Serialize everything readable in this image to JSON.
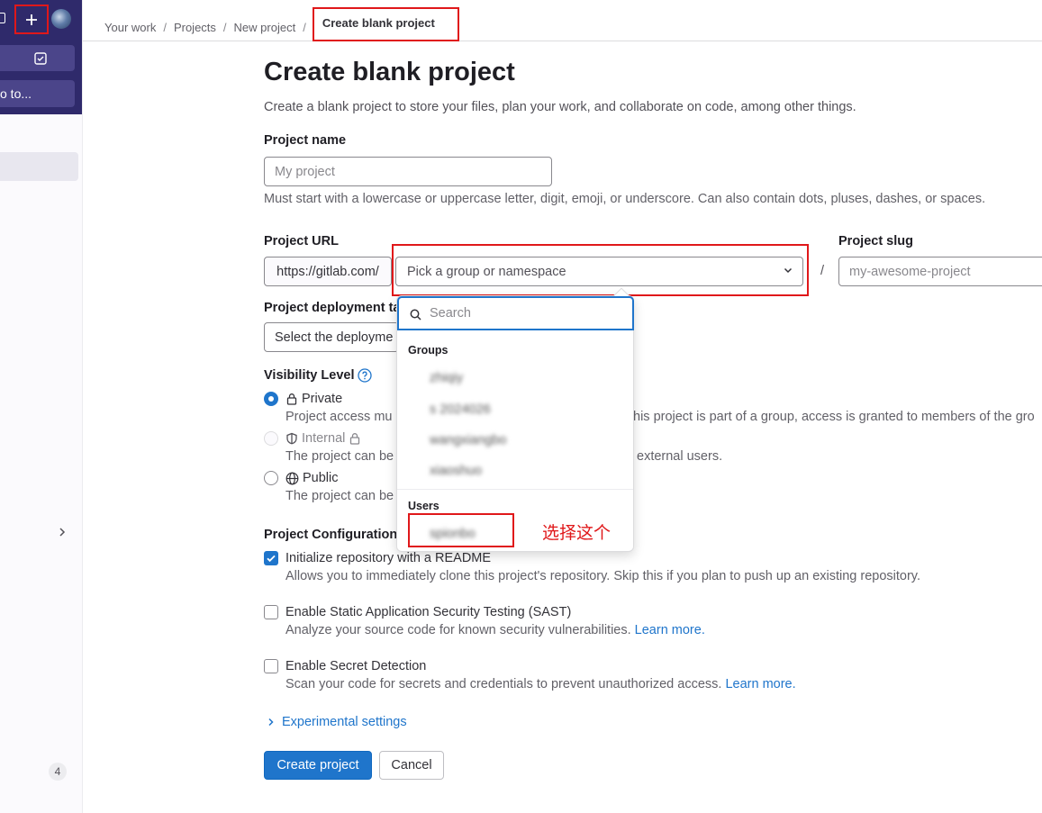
{
  "sidebar": {
    "plus_icon": "plus-icon",
    "todo_icon": "checkbox-icon",
    "goto_label": "o to...",
    "collapse_icon": "chevron-right-icon",
    "badge_count": "4"
  },
  "breadcrumbs": [
    {
      "label": "Your work"
    },
    {
      "label": "Projects"
    },
    {
      "label": "New project"
    },
    {
      "label": "Create blank project"
    }
  ],
  "page": {
    "title": "Create blank project",
    "subtitle": "Create a blank project to store your files, plan your work, and collaborate on code, among other things."
  },
  "form": {
    "project_name": {
      "label": "Project name",
      "placeholder": "My project",
      "hint": "Must start with a lowercase or uppercase letter, digit, emoji, or underscore. Can also contain dots, pluses, dashes, or spaces."
    },
    "project_url": {
      "label": "Project URL",
      "prefix": "https://gitlab.com/",
      "namespace_placeholder": "Pick a group or namespace",
      "separator": "/"
    },
    "project_slug": {
      "label": "Project slug",
      "placeholder": "my-awesome-project"
    },
    "deployment": {
      "label": "Project deployment ta",
      "placeholder": "Select the deployme"
    },
    "visibility": {
      "label": "Visibility Level",
      "help_icon": "question-circle-icon",
      "options": [
        {
          "label": "Private",
          "icon": "lock-icon",
          "selected": true,
          "desc_left": "Project access mu",
          "desc_right": "his project is part of a group, access is granted to members of the gro"
        },
        {
          "label": "Internal",
          "icon": "shield-icon",
          "disabled": true,
          "desc_left": "The project can be",
          "desc_right": "external users."
        },
        {
          "label": "Public",
          "icon": "globe-icon",
          "desc_left": "The project can be"
        }
      ]
    },
    "configuration": {
      "label": "Project Configuration",
      "items": [
        {
          "label": "Initialize repository with a README",
          "checked": true,
          "desc": "Allows you to immediately clone this project's repository. Skip this if you plan to push up an existing repository."
        },
        {
          "label": "Enable Static Application Security Testing (SAST)",
          "checked": false,
          "desc": "Analyze your source code for known security vulnerabilities.",
          "link": "Learn more."
        },
        {
          "label": "Enable Secret Detection",
          "checked": false,
          "desc": "Scan your code for secrets and credentials to prevent unauthorized access.",
          "link": "Learn more."
        }
      ]
    },
    "experimental": "Experimental settings",
    "submit": "Create project",
    "cancel": "Cancel"
  },
  "dropdown": {
    "search_placeholder": "Search",
    "groups_heading": "Groups",
    "groups": [
      "zhiqiy",
      "s 2024026",
      "wangxiangbo",
      "xiaoshuo"
    ],
    "users_heading": "Users",
    "users": [
      "spionbo"
    ]
  },
  "annotation": "选择这个",
  "colors": {
    "nav_bg": "#2f2a6b",
    "accent": "#1f75cb",
    "highlight_red": "#e0181a"
  }
}
